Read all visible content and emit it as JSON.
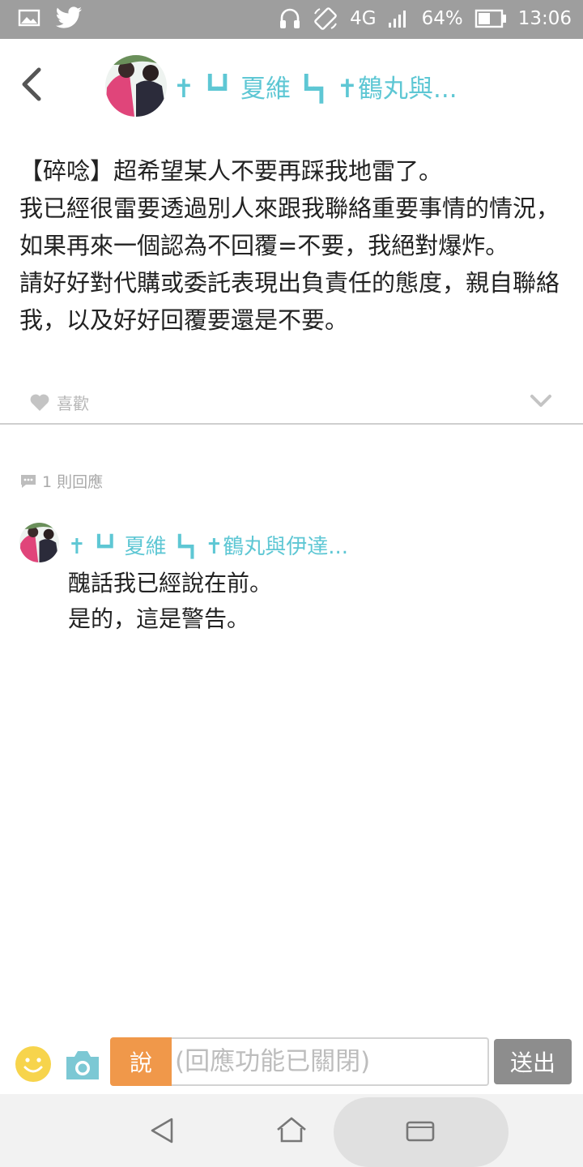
{
  "status_bar": {
    "network": "4G",
    "battery": "64%",
    "time": "13:06",
    "left_icons": [
      "image-icon",
      "twitter-icon"
    ],
    "right_icons": [
      "headphones-icon",
      "rotate-icon",
      "signal-icon",
      "battery-icon"
    ]
  },
  "header": {
    "title": "✝ ┗┛ 夏維 ┗┓ ✝鶴丸與..."
  },
  "post": {
    "body": "【碎唸】超希望某人不要再踩我地雷了。\n我已經很雷要透過別人來跟我聯絡重要事情的情況，如果再來一個認為不回覆=不要，我絕對爆炸。\n請好好對代購或委託表現出負責任的態度，親自聯絡我，以及好好回覆要還是不要。",
    "like_label": "喜歡"
  },
  "comments_meta": {
    "count_label": "1 則回應"
  },
  "comments": [
    {
      "author": "✝ ┗┛ 夏維 ┗┓ ✝鶴丸與伊達...",
      "text": "醜話我已經說在前。\n是的，這是警告。"
    }
  ],
  "reply_bar": {
    "say_label": "說",
    "placeholder": "(回應功能已關閉)",
    "send_label": "送出"
  },
  "colors": {
    "accent": "#5ec7d4",
    "status_bar": "#9e9e9e",
    "say_button": "#f0984a",
    "send_button": "#8d8d8d"
  }
}
